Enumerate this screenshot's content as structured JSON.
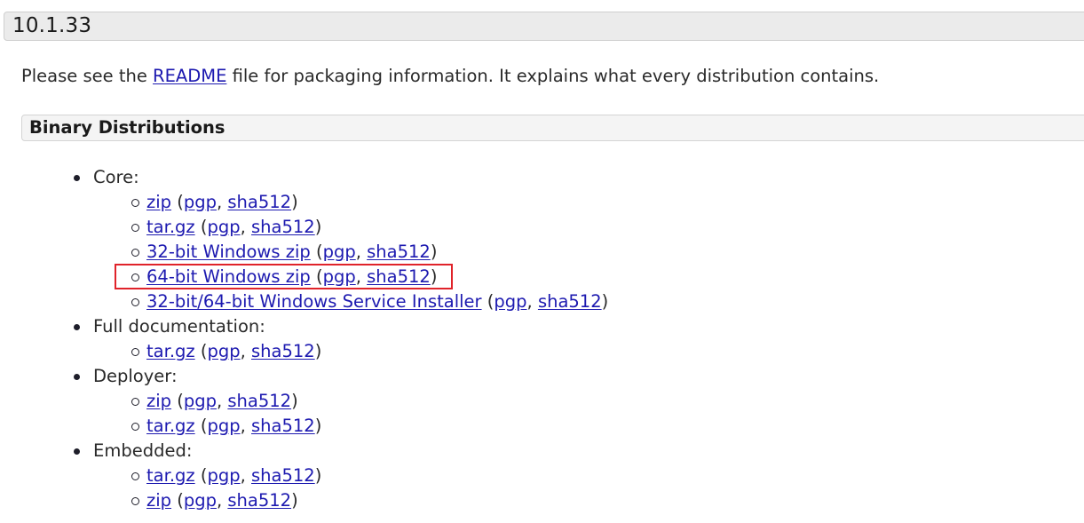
{
  "version": {
    "title": "10.1.33"
  },
  "intro": {
    "prefix": "Please see the ",
    "readme_link": "README",
    "suffix": " file for packaging information. It explains what every distribution contains."
  },
  "binary": {
    "title": "Binary Distributions",
    "groups": [
      {
        "label": "Core:",
        "items": [
          {
            "name": "zip",
            "pgp": "pgp",
            "sha": "sha512"
          },
          {
            "name": "tar.gz",
            "pgp": "pgp",
            "sha": "sha512"
          },
          {
            "name": "32-bit Windows zip",
            "pgp": "pgp",
            "sha": "sha512"
          },
          {
            "name": "64-bit Windows zip",
            "pgp": "pgp",
            "sha": "sha512",
            "highlighted": true
          },
          {
            "name": "32-bit/64-bit Windows Service Installer",
            "pgp": "pgp",
            "sha": "sha512"
          }
        ]
      },
      {
        "label": "Full documentation:",
        "items": [
          {
            "name": "tar.gz",
            "pgp": "pgp",
            "sha": "sha512"
          }
        ]
      },
      {
        "label": "Deployer:",
        "items": [
          {
            "name": "zip",
            "pgp": "pgp",
            "sha": "sha512"
          },
          {
            "name": "tar.gz",
            "pgp": "pgp",
            "sha": "sha512"
          }
        ]
      },
      {
        "label": "Embedded:",
        "items": [
          {
            "name": "tar.gz",
            "pgp": "pgp",
            "sha": "sha512"
          },
          {
            "name": "zip",
            "pgp": "pgp",
            "sha": "sha512"
          }
        ]
      }
    ]
  },
  "punctuation": {
    "open": " (",
    "comma": ", ",
    "close": ")"
  },
  "colors": {
    "link": "#1d1ab0",
    "highlight_border": "#e0232a",
    "header_bg": "#ebebeb"
  }
}
